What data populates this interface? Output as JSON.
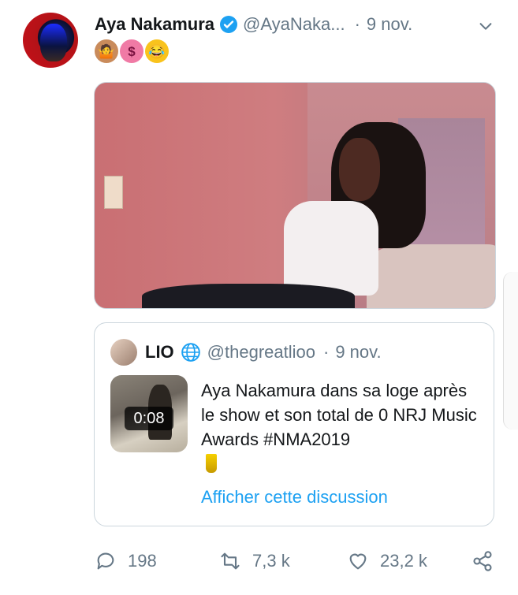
{
  "tweet": {
    "author_name": "Aya Nakamura",
    "author_handle": "@AyaNaka...",
    "separator": "·",
    "date": "9 nov.",
    "emoji_text": "🤷🏾‍♀️🤑🤣"
  },
  "quoted_tweet": {
    "author_name": "LIO",
    "author_handle": "@thegreatlioo",
    "separator": "·",
    "date": "9 nov.",
    "video_duration": "0:08",
    "text": "Aya Nakamura dans sa loge après le show et son total de 0 NRJ Music Awards #NMA2019",
    "show_thread_link": "Afficher cette discussion"
  },
  "actions": {
    "replies": "198",
    "retweets": "7,3 k",
    "likes": "23,2 k"
  },
  "colors": {
    "link_blue": "#1da1f2",
    "muted_gray": "#657786",
    "border": "#ccd6dd"
  },
  "icons": [
    "verified-badge-icon",
    "chevron-down-icon",
    "globe-icon",
    "reply-icon",
    "retweet-icon",
    "like-icon",
    "share-icon"
  ]
}
